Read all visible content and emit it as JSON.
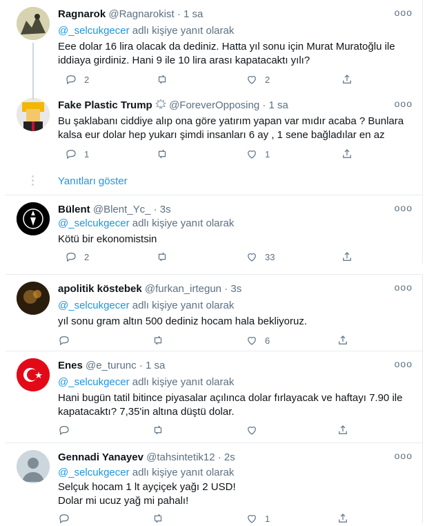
{
  "tweets": [
    {
      "name": "Ragnarok",
      "handle": "@Ragnarokist",
      "time": "· 1 sa",
      "reply_prefix": "@_selcukgecer",
      "reply_suffix": " adlı kişiye yanıt olarak",
      "lines": [
        "Eee dolar 16 lira olacak da dediniz. Hatta  yıl sonu için Murat Muratoğlu ile",
        "iddiaya girdiniz. Hani 9 ile 10 lira arası kapatacaktı yılı?"
      ],
      "replies": "2",
      "retweets": "",
      "likes": "2"
    },
    {
      "name": "Fake Plastic Trump",
      "handle": "@ForeverOpposing",
      "time": "· 1 sa",
      "reply_prefix": "",
      "reply_suffix": "",
      "lines": [
        "Bu şaklabanı ciddiye alıp ona göre yatırım yapan var mıdır acaba ? Bunlara",
        "kalsa eur dolar hep yukarı şimdi insanları 6 ay , 1 sene bağladılar en az"
      ],
      "replies": "1",
      "retweets": "",
      "likes": "1"
    },
    {
      "name": "Bülent",
      "handle": "@Blent_Yc_",
      "time": "· 3s",
      "reply_prefix": "@_selcukgecer",
      "reply_suffix": " adlı kişiye yanıt olarak",
      "lines": [
        "Kötü bir ekonomistsin"
      ],
      "replies": "2",
      "retweets": "",
      "likes": "33"
    },
    {
      "name": "apolitik köstebek",
      "handle": "@furkan_irtegun",
      "time": "· 3s",
      "reply_prefix": "@_selcukgecer",
      "reply_suffix": " adlı kişiye yanıt olarak",
      "lines": [
        "yıl sonu gram altın 500 dediniz hocam hala bekliyoruz."
      ],
      "replies": "",
      "retweets": "",
      "likes": "6"
    },
    {
      "name": "Enes",
      "handle": "@e_turunc",
      "time": "· 1 sa",
      "reply_prefix": "@_selcukgecer",
      "reply_suffix": " adlı kişiye yanıt olarak",
      "lines": [
        "Hani bugün tatil bitince piyasalar açılınca dolar fırlayacak ve haftayı 7.90 ile",
        "kapatacaktı? 7,35'in altına düştü dolar."
      ],
      "replies": "",
      "retweets": "",
      "likes": ""
    },
    {
      "name": "Gennadi Yanayev",
      "handle": "@tahsintetik12",
      "time": "· 2s",
      "reply_prefix": "@_selcukgecer",
      "reply_suffix": " adlı kişiye yanıt olarak",
      "lines": [
        "Selçuk hocam 1 lt ayçiçek yağı 2 USD!",
        "Dolar mi ucuz yağ mi pahalı!"
      ],
      "replies": "",
      "retweets": "",
      "likes": "1"
    }
  ],
  "show_replies_label": "Yanıtları göster",
  "more_glyph": "ooo",
  "icons": {
    "reply": "reply-icon",
    "retweet": "retweet-icon",
    "like": "like-icon",
    "share": "share-icon",
    "badge": "burst-badge-icon",
    "avatar_placeholder": "default-avatar-icon"
  },
  "colors": {
    "link": "#1b95e0",
    "muted": "#5b7083",
    "text": "#0f1419",
    "divider": "#e6ecf0"
  }
}
